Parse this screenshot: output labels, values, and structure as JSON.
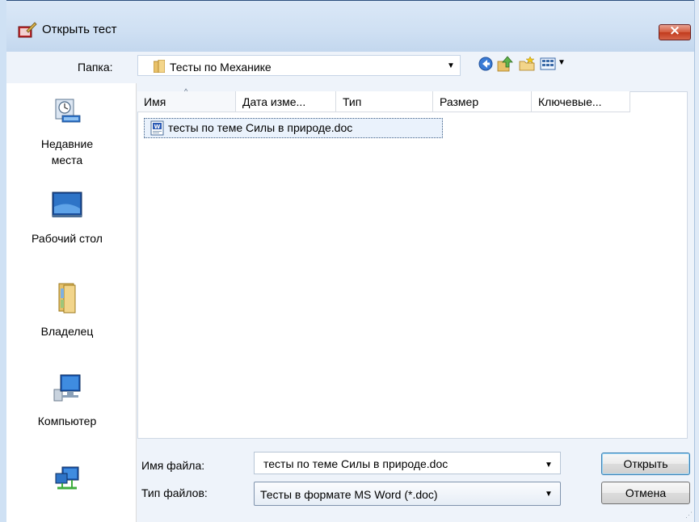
{
  "window": {
    "title": "Открыть тест",
    "close_glyph": "×"
  },
  "toolbar": {
    "look_in_label": "Папка:",
    "look_in_value": "Тесты по Механике",
    "icons": [
      "back-icon",
      "up-folder-icon",
      "new-folder-icon",
      "views-menu-icon"
    ]
  },
  "places": [
    {
      "label_line1": "Недавние",
      "label_line2": "места",
      "icon": "recent-places-icon"
    },
    {
      "label_line1": "Рабочий стол",
      "label_line2": "",
      "icon": "desktop-icon"
    },
    {
      "label_line1": "Владелец",
      "label_line2": "",
      "icon": "user-folder-icon"
    },
    {
      "label_line1": "Компьютер",
      "label_line2": "",
      "icon": "computer-icon"
    },
    {
      "label_line1": "",
      "label_line2": "",
      "icon": "network-icon"
    }
  ],
  "file_list": {
    "columns": [
      "Имя",
      "Дата изме...",
      "Тип",
      "Размер",
      "Ключевые..."
    ],
    "sort_glyph": "^",
    "files": [
      {
        "name": "тесты по теме Силы в природе.doc",
        "icon": "word-doc-icon"
      }
    ]
  },
  "footer": {
    "file_name_label": "Имя файла:",
    "file_name_value": "тесты по теме Силы в природе.doc",
    "file_type_label": "Тип файлов:",
    "file_type_value": "Тесты в формате MS Word (*.doc)",
    "open_button": "Открыть",
    "cancel_button": "Отмена"
  },
  "colors": {
    "titlebar": "#cfe0f3",
    "close_button": "#d35a3b",
    "accent": "#3c7fb1"
  }
}
